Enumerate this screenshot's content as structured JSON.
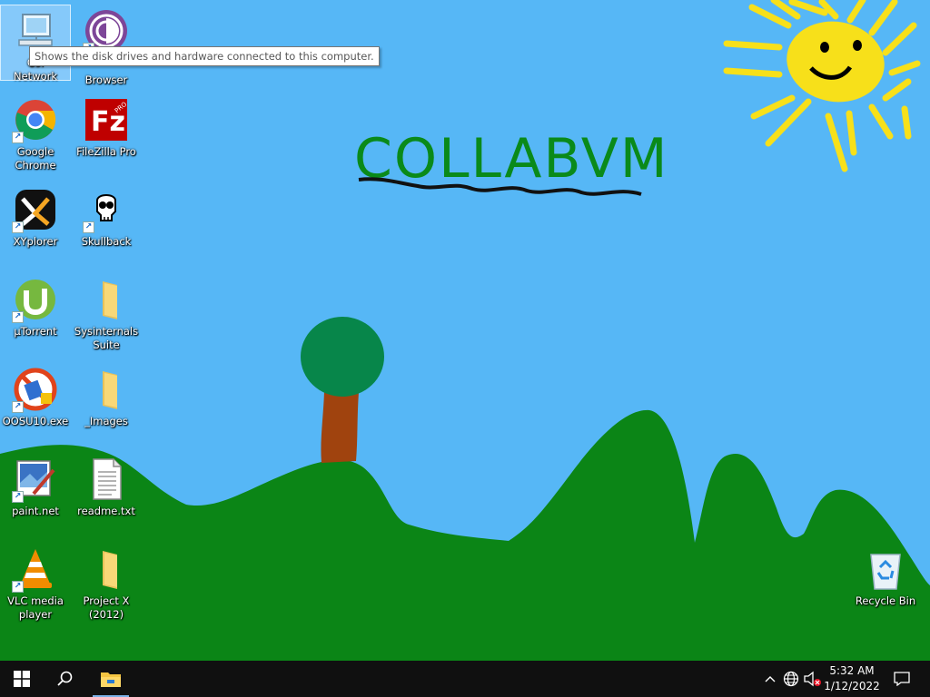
{
  "tooltip": "Shows the disk drives and hardware connected to this computer.",
  "wallpaper": {
    "title_text": "COLLABVM"
  },
  "desktop_icons": {
    "computer": {
      "label_line1": "Col",
      "label_line2": "Network"
    },
    "browser": {
      "label": "Browser"
    },
    "chrome": {
      "label_line1": "Google",
      "label_line2": "Chrome"
    },
    "filezilla": {
      "label": "FileZilla Pro"
    },
    "xyplorer": {
      "label": "XYplorer"
    },
    "skullback": {
      "label": "Skullback"
    },
    "utorrent": {
      "label": "µTorrent"
    },
    "sysinternals": {
      "label_line1": "Sysinternals",
      "label_line2": "Suite"
    },
    "oosu10": {
      "label": "OOSU10.exe"
    },
    "images": {
      "label": "_Images"
    },
    "paintnet": {
      "label": "paint.net"
    },
    "readme": {
      "label": "readme.txt"
    },
    "vlc": {
      "label_line1": "VLC media",
      "label_line2": "player"
    },
    "projectx": {
      "label_line1": "Project X",
      "label_line2": "(2012)"
    },
    "recycle": {
      "label": "Recycle Bin"
    }
  },
  "taskbar": {
    "time": "5:32 AM",
    "date": "1/12/2022"
  },
  "colors": {
    "sky": "#56b7f6",
    "hills": "#0b8516",
    "sun": "#f7e01a",
    "taskbar": "#101010"
  }
}
